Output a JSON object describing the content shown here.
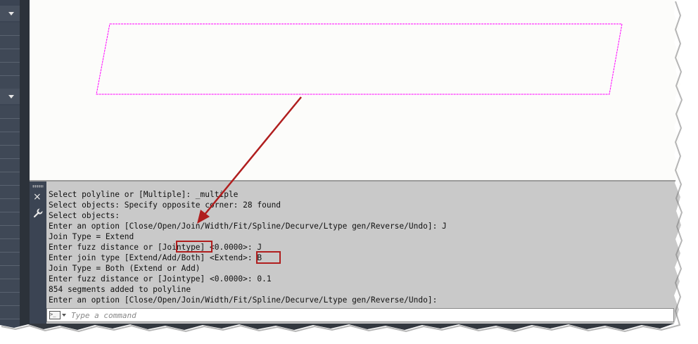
{
  "command_history": [
    "Select polyline or [Multiple]: _multiple",
    "Select objects: Specify opposite corner: 28 found",
    "Select objects:",
    "Enter an option [Close/Open/Join/Width/Fit/Spline/Decurve/Ltype gen/Reverse/Undo]: J",
    "Join Type = Extend",
    "Enter fuzz distance or [Jointype] <0.0000>: J",
    "Enter join type [Extend/Add/Both] <Extend>: B",
    "Join Type = Both (Extend or Add)",
    "Enter fuzz distance or [Jointype] <0.0000>: 0.1",
    "854 segments added to polyline",
    "Enter an option [Close/Open/Join/Width/Fit/Spline/Decurve/Ltype gen/Reverse/Undo]:"
  ],
  "command_input": {
    "placeholder": "Type a command"
  },
  "side_icons": {
    "close": "×",
    "customize": "wrench-icon"
  },
  "colors": {
    "polyline": "#ff00ff",
    "callout": "#b01e1e",
    "canvas_bg": "#fcfcfa",
    "command_bg": "#c9c9c9",
    "panel_bg": "#3b4453"
  }
}
